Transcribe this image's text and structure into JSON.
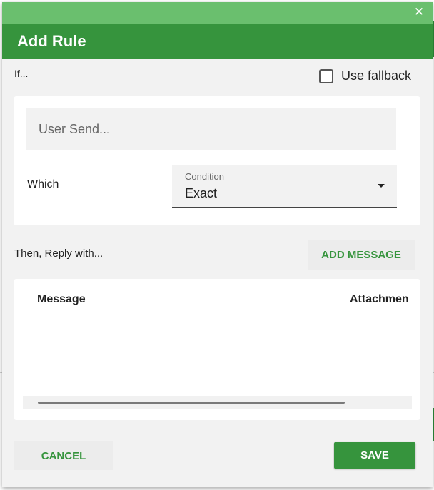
{
  "dialog": {
    "title": "Add Rule",
    "close_icon": "close-icon",
    "close_glyph": "✕"
  },
  "condition": {
    "if_label": "If...",
    "fallback_label": "Use fallback",
    "fallback_checked": false,
    "user_send_placeholder": "User Send...",
    "user_send_value": "",
    "which_label": "Which",
    "select_caption": "Condition",
    "select_value": "Exact",
    "select_icon": "caret-down-icon"
  },
  "reply": {
    "label": "Then, Reply with...",
    "add_message_label": "ADD MESSAGE",
    "columns": [
      "Message",
      "Attachmen"
    ],
    "rows": []
  },
  "footer": {
    "cancel_label": "CANCEL",
    "save_label": "SAVE"
  },
  "colors": {
    "topbar": "#6abf6e",
    "header": "#36943d",
    "accent": "#36943d"
  }
}
